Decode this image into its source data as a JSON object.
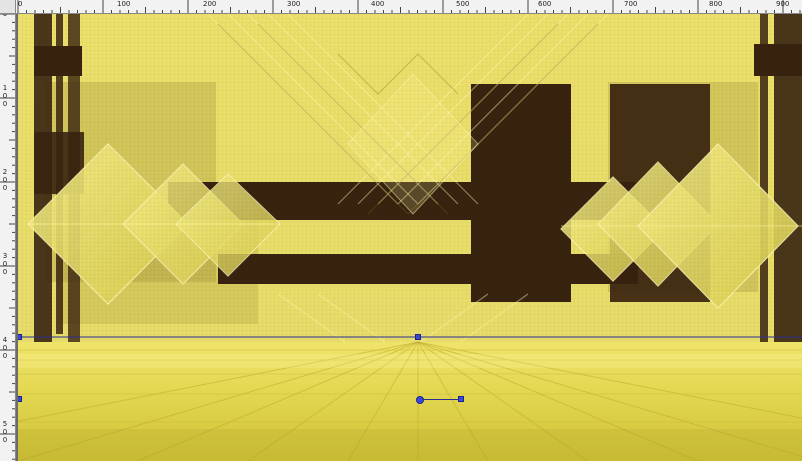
{
  "canvas": {
    "width": 802,
    "height": 461
  },
  "ruler": {
    "top_labels": [
      "0",
      "100",
      "200",
      "300",
      "400",
      "500",
      "600",
      "700",
      "800",
      "900"
    ],
    "left_labels": [
      "0",
      "100",
      "200",
      "300",
      "400",
      "500"
    ]
  },
  "colors": {
    "yellow_light": "#f2ea7c",
    "yellow": "#e2d85a",
    "yellow_dark": "#b7ab3a",
    "brown": "#38230f",
    "handle": "#3a48d8"
  },
  "tool": {
    "name": "perspective-deform-tool",
    "horizon_line": "visible"
  }
}
